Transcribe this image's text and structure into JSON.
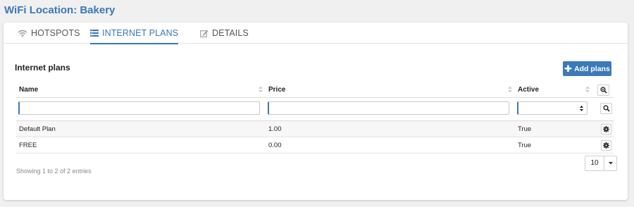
{
  "page": {
    "title": "WiFi Location: Bakery"
  },
  "tabs": [
    {
      "label": "HOTSPOTS",
      "icon": "wifi-icon",
      "active": false
    },
    {
      "label": "INTERNET PLANS",
      "icon": "list-icon",
      "active": true
    },
    {
      "label": "DETAILS",
      "icon": "edit-icon",
      "active": false
    }
  ],
  "section": {
    "title": "Internet plans",
    "add_label": "Add plans"
  },
  "table": {
    "columns": [
      "Name",
      "Price",
      "Active"
    ],
    "rows": [
      {
        "name": "Default Plan",
        "price": "1.00",
        "active": "True"
      },
      {
        "name": "FREE",
        "price": "0.00",
        "active": "True"
      }
    ],
    "filter_values": {
      "name": "",
      "price": "",
      "active": ""
    }
  },
  "footer": {
    "info": "Showing 1 to 2 of 2 entries",
    "page_size": "10"
  },
  "colors": {
    "accent": "#3a78b5",
    "button": "#3a7ab8"
  }
}
